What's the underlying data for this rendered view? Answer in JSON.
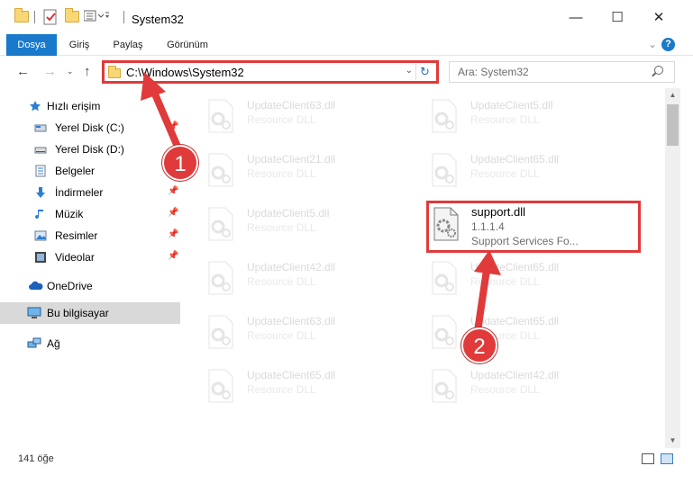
{
  "window": {
    "title": "System32",
    "minimize": "—",
    "maximize": "☐",
    "close": "✕"
  },
  "ribbon": {
    "tabs": [
      {
        "label": "Dosya",
        "active": true
      },
      {
        "label": "Giriş",
        "active": false
      },
      {
        "label": "Paylaş",
        "active": false
      },
      {
        "label": "Görünüm",
        "active": false
      }
    ],
    "help": "?",
    "accent": "#1979ca"
  },
  "address": {
    "path": "C:\\Windows\\System32",
    "search_placeholder": "Ara: System32"
  },
  "sidebar": {
    "items": [
      {
        "label": "Hızlı erişim",
        "icon": "star-icon"
      },
      {
        "label": "Yerel Disk (C:)",
        "icon": "drive-icon",
        "pinned": true
      },
      {
        "label": "Yerel Disk (D:)",
        "icon": "drive-icon"
      },
      {
        "label": "Belgeler",
        "icon": "documents-icon"
      },
      {
        "label": "İndirmeler",
        "icon": "download-icon",
        "pinned": true
      },
      {
        "label": "Müzik",
        "icon": "music-icon",
        "pinned": true
      },
      {
        "label": "Resimler",
        "icon": "pictures-icon",
        "pinned": true
      },
      {
        "label": "Videolar",
        "icon": "videos-icon",
        "pinned": true
      },
      {
        "label": "OneDrive",
        "icon": "cloud-icon"
      },
      {
        "label": "Bu bilgisayar",
        "icon": "computer-icon",
        "selected": true
      },
      {
        "label": "Ağ",
        "icon": "network-icon"
      }
    ]
  },
  "files": {
    "left": [
      {
        "name": "UpdateClient63.dll",
        "type": "Resource DLL"
      },
      {
        "name": "UpdateClient21.dll",
        "type": "Resource DLL"
      },
      {
        "name": "UpdateClient5.dll",
        "type": "Resource DLL"
      },
      {
        "name": "UpdateClient42.dll",
        "type": "Resource DLL"
      },
      {
        "name": "UpdateClient63.dll",
        "type": "Resource DLL"
      },
      {
        "name": "UpdateClient65.dll",
        "type": "Resource DLL"
      }
    ],
    "right": [
      {
        "name": "UpdateClient5.dll",
        "type": "Resource DLL"
      },
      {
        "name": "UpdateClient65.dll",
        "type": "Resource DLL"
      },
      {
        "name": "support.dll",
        "version": "1.1.1.4",
        "type": "Support Services Fo...",
        "highlighted": true
      },
      {
        "name": "UpdateClient65.dll",
        "type": "Resource DLL"
      },
      {
        "name": "UpdateClient65.dll",
        "type": "Resource DLL"
      },
      {
        "name": "UpdateClient42.dll",
        "type": "Resource DLL"
      }
    ]
  },
  "status": {
    "count": "141 öğe"
  },
  "annotations": {
    "step1": "1",
    "step2": "2",
    "color": "#e03a3a"
  }
}
